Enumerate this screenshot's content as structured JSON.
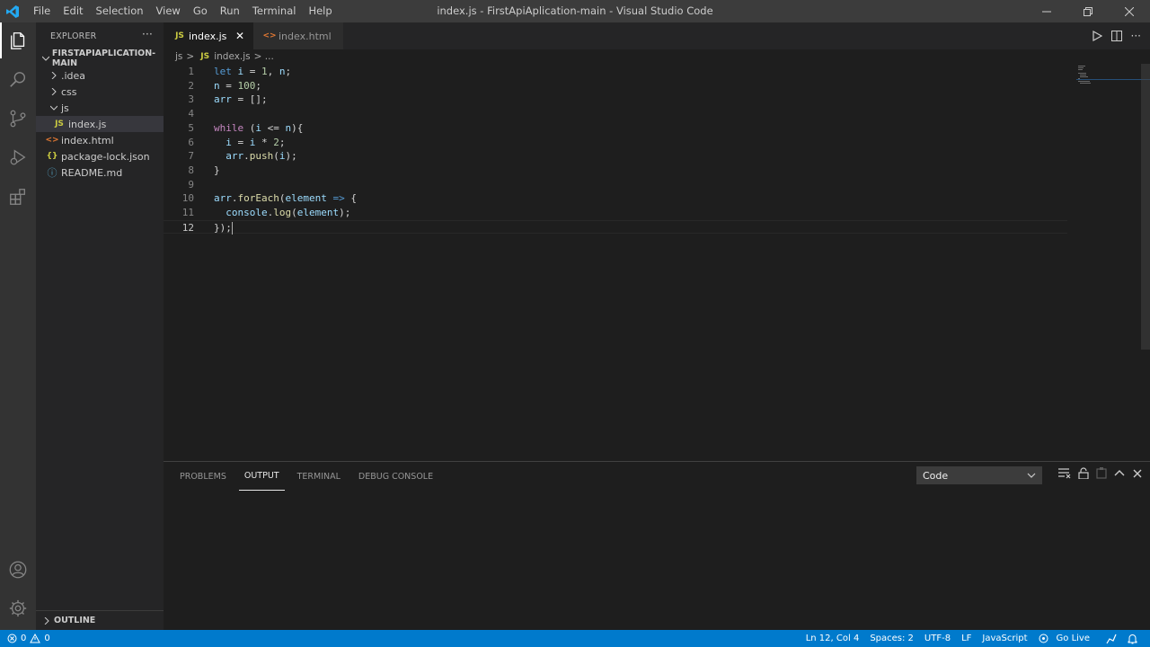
{
  "window": {
    "title": "index.js - FirstApiAplication-main - Visual Studio Code",
    "menu": [
      "File",
      "Edit",
      "Selection",
      "View",
      "Go",
      "Run",
      "Terminal",
      "Help"
    ]
  },
  "sidebar": {
    "title": "EXPLORER",
    "more": "···",
    "folder": "FIRSTAPIAPLICATION-MAIN",
    "items": [
      {
        "label": ".idea",
        "icon": "chevron-right-icon"
      },
      {
        "label": "css",
        "icon": "chevron-right-icon"
      },
      {
        "label": "js",
        "icon": "chevron-down-icon"
      },
      {
        "label": "index.js",
        "badge": "JS"
      },
      {
        "label": "index.html",
        "badge": "<>"
      },
      {
        "label": "package-lock.json",
        "badge": "{}"
      },
      {
        "label": "README.md",
        "badge": "ⓘ"
      }
    ],
    "outline": "OUTLINE"
  },
  "tabs": [
    {
      "label": "index.js",
      "badge": "JS",
      "close": "✕"
    },
    {
      "label": "index.html",
      "badge": "<>"
    }
  ],
  "breadcrumb": {
    "folder": "js",
    "sep": ">",
    "badge": "JS",
    "file": "index.js",
    "tail": "> ..."
  },
  "editor": {
    "lines": [
      {
        "n": "1",
        "parts": [
          [
            "kw",
            "let"
          ],
          [
            "",
            ""
          ],
          [
            "var",
            " i"
          ],
          [
            "",
            " = "
          ],
          [
            "num",
            "1"
          ],
          [
            "",
            ", "
          ],
          [
            "var",
            "n"
          ],
          [
            "",
            ";"
          ]
        ]
      },
      {
        "n": "2",
        "parts": [
          [
            "var",
            "n"
          ],
          [
            "",
            " = "
          ],
          [
            "num",
            "100"
          ],
          [
            "",
            ";"
          ]
        ]
      },
      {
        "n": "3",
        "parts": [
          [
            "var",
            "arr"
          ],
          [
            "",
            " = [];"
          ]
        ]
      },
      {
        "n": "4",
        "parts": []
      },
      {
        "n": "5",
        "parts": [
          [
            "kw2",
            "while"
          ],
          [
            "",
            " ("
          ],
          [
            "var",
            "i"
          ],
          [
            "",
            " <= "
          ],
          [
            "var",
            "n"
          ],
          [
            "",
            "){"
          ]
        ]
      },
      {
        "n": "6",
        "parts": [
          [
            "",
            "  "
          ],
          [
            "var",
            "i"
          ],
          [
            "",
            " = "
          ],
          [
            "var",
            "i"
          ],
          [
            "",
            " * "
          ],
          [
            "num",
            "2"
          ],
          [
            "",
            ";"
          ]
        ]
      },
      {
        "n": "7",
        "parts": [
          [
            "",
            "  "
          ],
          [
            "var",
            "arr"
          ],
          [
            "",
            "."
          ],
          [
            "fn",
            "push"
          ],
          [
            "",
            "("
          ],
          [
            "var",
            "i"
          ],
          [
            "",
            ");"
          ]
        ]
      },
      {
        "n": "8",
        "parts": [
          [
            "",
            "}"
          ]
        ]
      },
      {
        "n": "9",
        "parts": []
      },
      {
        "n": "10",
        "parts": [
          [
            "var",
            "arr"
          ],
          [
            "",
            "."
          ],
          [
            "fn",
            "forEach"
          ],
          [
            "",
            "("
          ],
          [
            "var",
            "element"
          ],
          [
            "",
            " "
          ],
          [
            "kw",
            "=>"
          ],
          [
            "",
            " {"
          ]
        ]
      },
      {
        "n": "11",
        "parts": [
          [
            "",
            "  "
          ],
          [
            "var",
            "console"
          ],
          [
            "",
            "."
          ],
          [
            "fn",
            "log"
          ],
          [
            "",
            "("
          ],
          [
            "var",
            "element"
          ],
          [
            "",
            ");"
          ]
        ]
      },
      {
        "n": "12",
        "parts": [
          [
            "",
            "});"
          ]
        ]
      }
    ],
    "current_line": 12
  },
  "panel": {
    "tabs": [
      "PROBLEMS",
      "OUTPUT",
      "TERMINAL",
      "DEBUG CONSOLE"
    ],
    "active_tab": "OUTPUT",
    "select_value": "Code"
  },
  "status": {
    "errors": "0",
    "warnings": "0",
    "position": "Ln 12, Col 4",
    "spaces": "Spaces: 2",
    "encoding": "UTF-8",
    "eol": "LF",
    "language": "JavaScript",
    "golive": "Go Live"
  }
}
